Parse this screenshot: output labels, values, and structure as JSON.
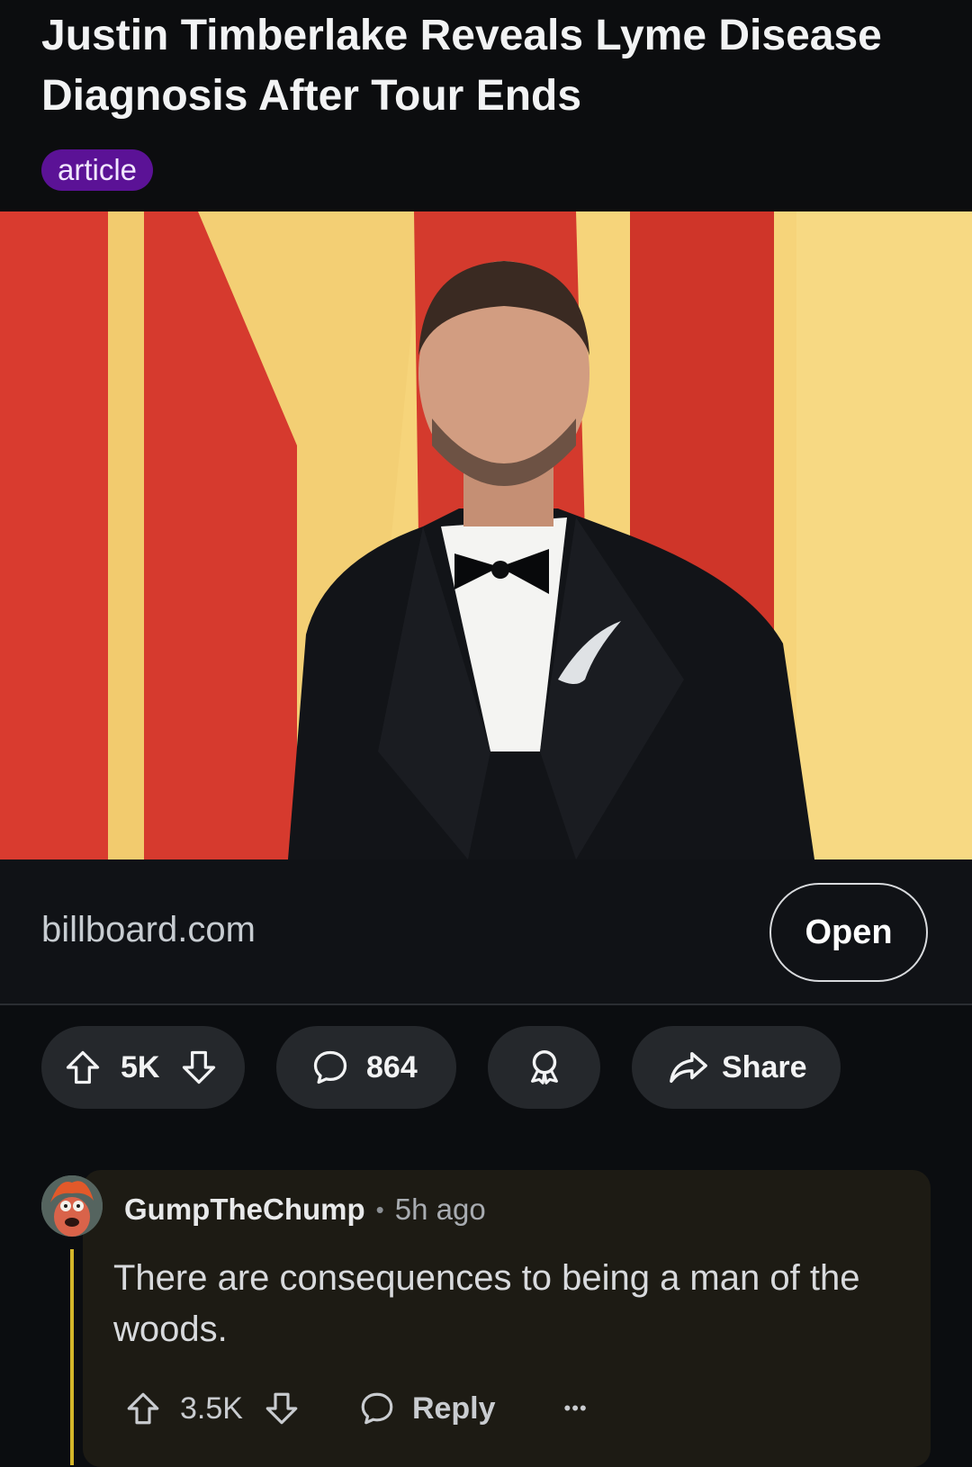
{
  "post": {
    "title": "Justin Timberlake Reveals Lyme Disease Diagnosis After Tour Ends",
    "flair": "article",
    "link_domain": "billboard.com",
    "open_label": "Open"
  },
  "actions": {
    "upvotes": "5K",
    "comments": "864",
    "share_label": "Share"
  },
  "comment": {
    "username": "GumpTheChump",
    "separator": "•",
    "time_ago": "5h ago",
    "body": "There are consequences to being a man of the woods.",
    "score": "3.5K",
    "reply_label": "Reply",
    "more": "•••"
  },
  "colors": {
    "flair_bg": "#5b1296",
    "thread_line": "#d4b62a",
    "pill_bg": "#25282c"
  }
}
